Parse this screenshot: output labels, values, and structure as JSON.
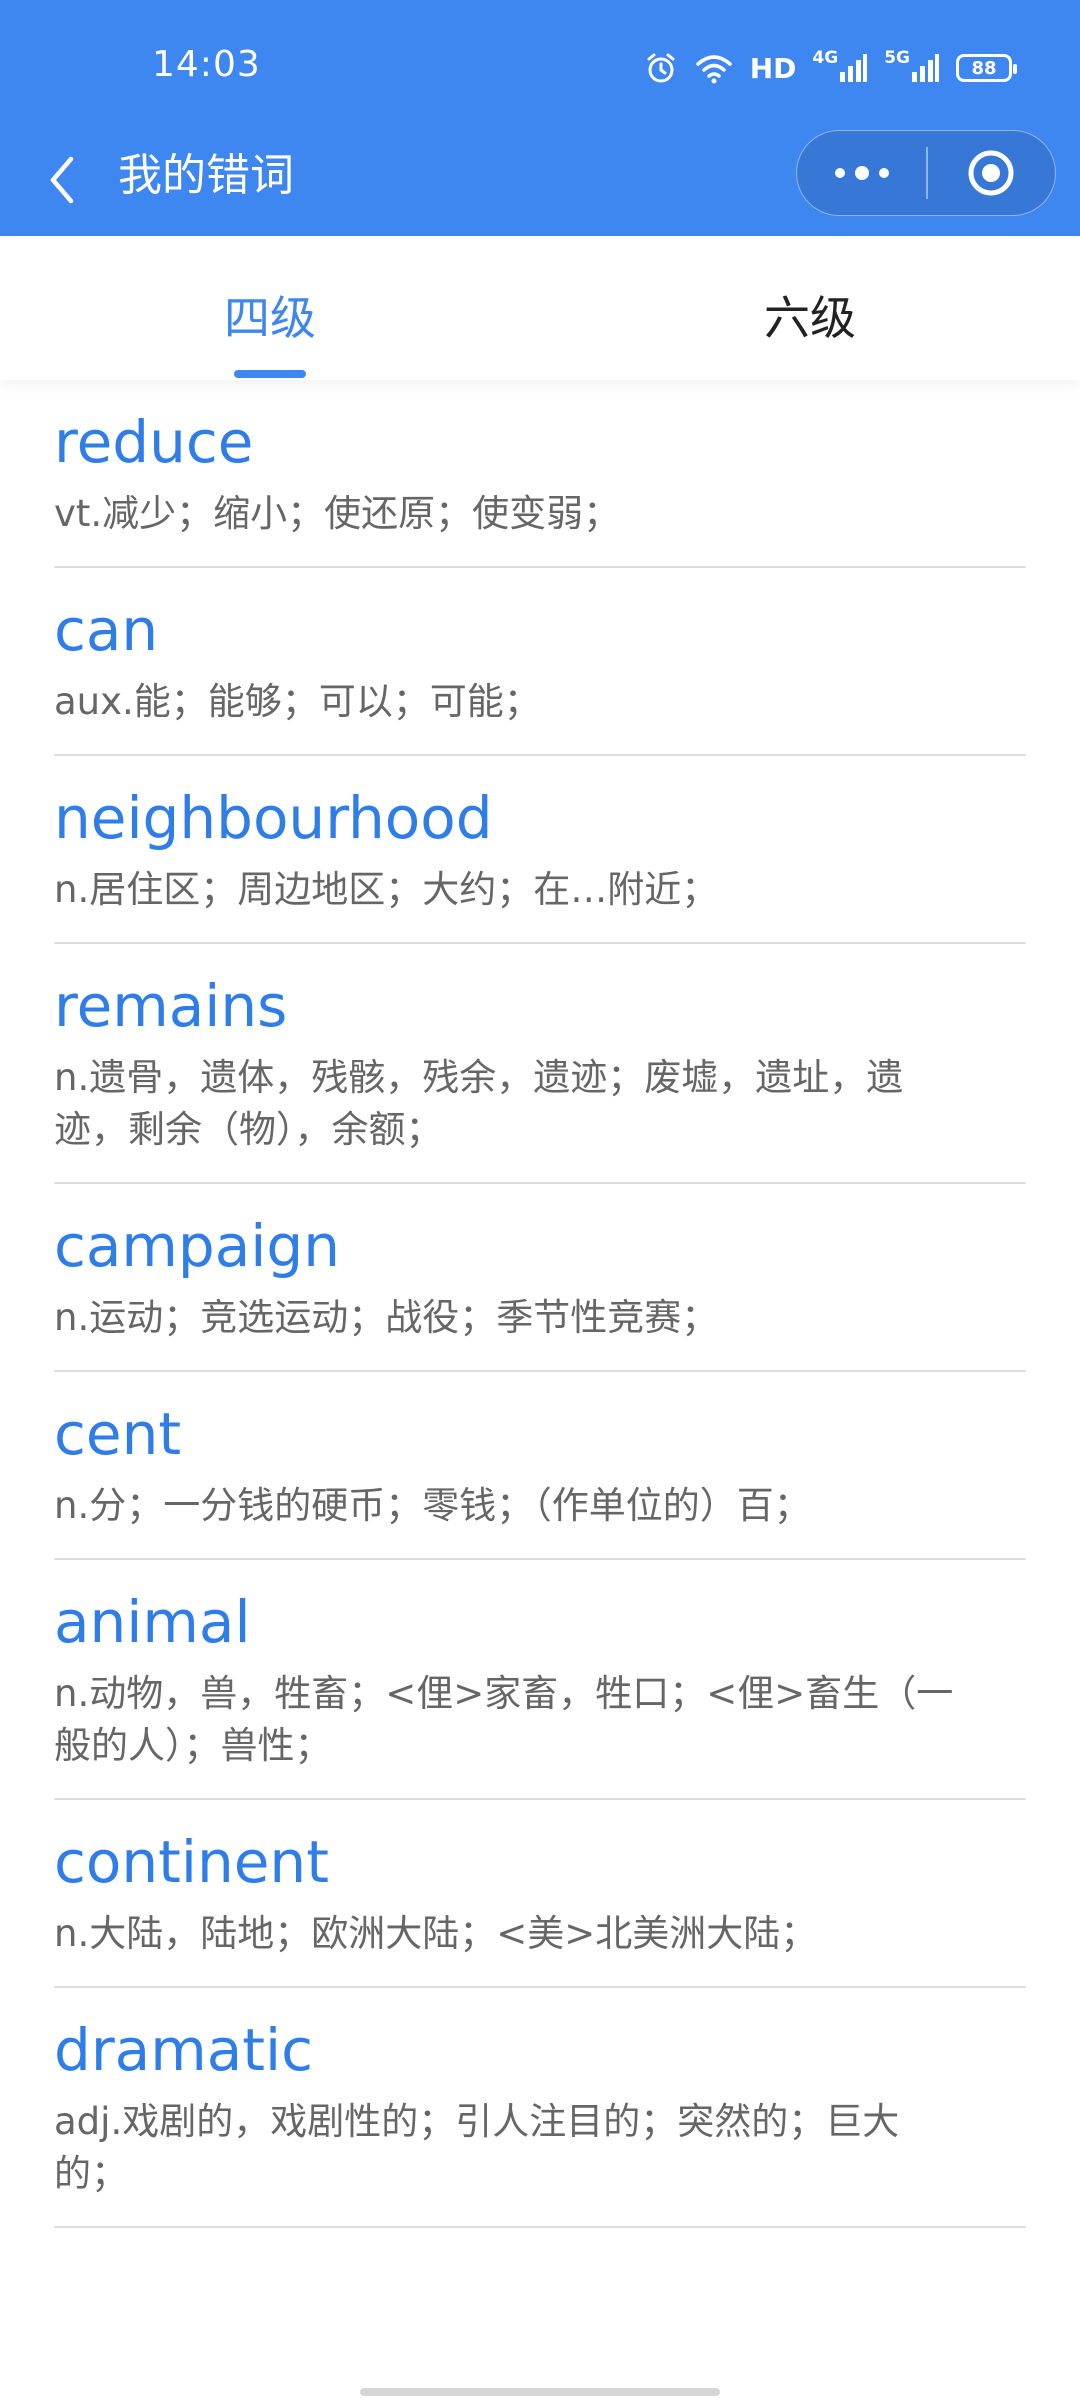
{
  "status_bar": {
    "time": "14:03",
    "hd": "HD",
    "network1": "4G",
    "network2": "5G",
    "battery": "88"
  },
  "nav": {
    "title": "我的错词"
  },
  "tabs": [
    {
      "label": "四级",
      "active": true
    },
    {
      "label": "六级",
      "active": false
    }
  ],
  "words": [
    {
      "word": "reduce",
      "meaning": "vt.减少；缩小；使还原；使变弱；"
    },
    {
      "word": "can",
      "meaning": "aux.能；能够；可以；可能；"
    },
    {
      "word": "neighbourhood",
      "meaning": "n.居住区；周边地区；大约；在…附近；"
    },
    {
      "word": "remains",
      "meaning": "n.遗骨，遗体，残骸，残余，遗迹；废墟，遗址，遗迹，剩余（物），余额；"
    },
    {
      "word": "campaign",
      "meaning": "n.运动；竞选运动；战役；季节性竞赛；"
    },
    {
      "word": "cent",
      "meaning": "n.分；一分钱的硬币；零钱；（作单位的）百；"
    },
    {
      "word": "animal",
      "meaning": "n.动物，兽，牲畜；<俚>家畜，牲口；<俚>畜生（一般的人）；兽性；"
    },
    {
      "word": "continent",
      "meaning": "n.大陆，陆地；欧洲大陆；<美>北美洲大陆；"
    },
    {
      "word": "dramatic",
      "meaning": "adj.戏剧的，戏剧性的；引人注目的；突然的；巨大的；"
    }
  ],
  "colors": {
    "accent": "#3e86f0",
    "word": "#2f7de9",
    "meaning": "#666666",
    "divider": "#dedede"
  }
}
